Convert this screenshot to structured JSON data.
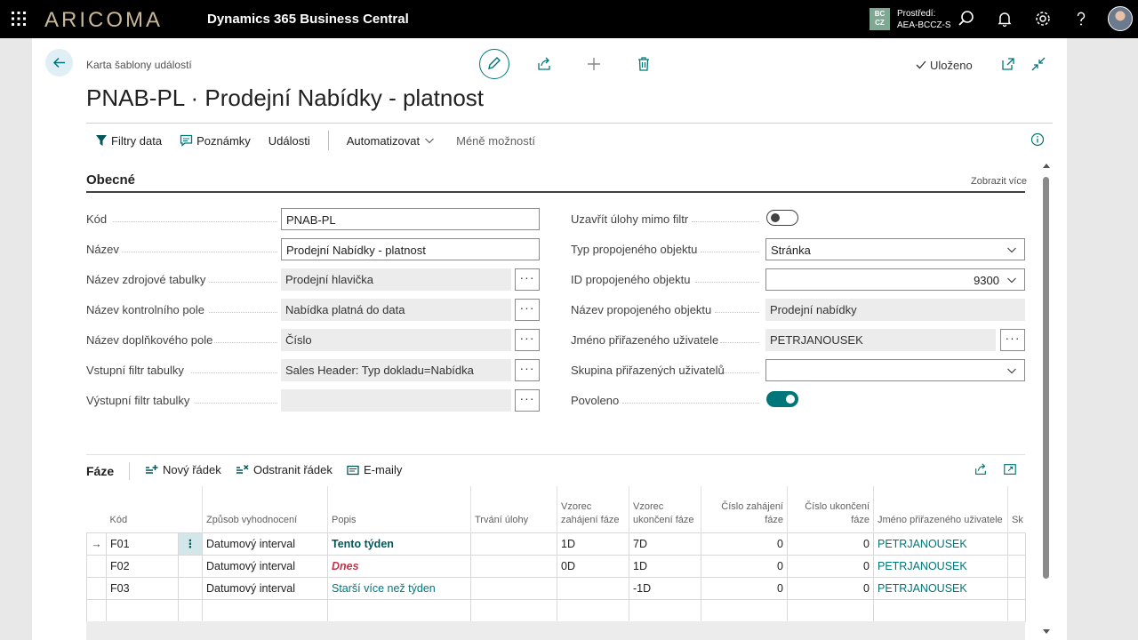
{
  "topbar": {
    "logo": "ARICOMA",
    "app_title": "Dynamics 365 Business Central",
    "env_badge_line1": "BC",
    "env_badge_line2": "CZ",
    "env_label": "Prostředí:",
    "env_name": "AEA-BCCZ-S"
  },
  "header": {
    "breadcrumb": "Karta šablony událostí",
    "title": "PNAB-PL · Prodejní Nabídky - platnost",
    "saved_label": "Uloženo"
  },
  "actions": {
    "filters": "Filtry data",
    "notes": "Poznámky",
    "events": "Události",
    "automate": "Automatizovat",
    "fewer": "Méně možností"
  },
  "section": {
    "title": "Obecné",
    "show_more": "Zobrazit více"
  },
  "fields_left": [
    {
      "label": "Kód",
      "value": "PNAB-PL"
    },
    {
      "label": "Název",
      "value": "Prodejní Nabídky - platnost"
    },
    {
      "label": "Název zdrojové tabulky",
      "value": "Prodejní hlavička"
    },
    {
      "label": "Název kontrolního pole",
      "value": "Nabídka platná do data"
    },
    {
      "label": "Název doplňkového pole",
      "value": "Číslo"
    },
    {
      "label": "Vstupní filtr tabulky",
      "value": "Sales Header: Typ dokladu=Nabídka"
    },
    {
      "label": "Výstupní filtr tabulky",
      "value": ""
    }
  ],
  "fields_right": [
    {
      "label": "Uzavřít úlohy mimo filtr",
      "value": "off"
    },
    {
      "label": "Typ propojeného objektu",
      "value": "Stránka"
    },
    {
      "label": "ID propojeného objektu",
      "value": "9300"
    },
    {
      "label": "Název propojeného objektu",
      "value": "Prodejní nabídky"
    },
    {
      "label": "Jméno přiřazeného uživatele",
      "value": "PETRJANOUSEK"
    },
    {
      "label": "Skupina přiřazených uživatelů",
      "value": ""
    },
    {
      "label": "Povoleno",
      "value": "on"
    }
  ],
  "lines": {
    "title": "Fáze",
    "new_line": "Nový řádek",
    "delete_line": "Odstranit řádek",
    "emails": "E-maily",
    "columns": {
      "code": "Kód",
      "method": "Způsob vyhodnocení",
      "desc": "Popis",
      "duration": "Trvání úlohy",
      "start_formula": "Vzorec zahájení fáze",
      "end_formula": "Vzorec ukončení fáze",
      "start_no": "Číslo zahájení fáze",
      "end_no": "Číslo ukončení fáze",
      "user": "Jméno přiřazeného uživatele",
      "group": "Sk pří uži"
    },
    "rows": [
      {
        "code": "F01",
        "method": "Datumový interval",
        "desc": "Tento týden",
        "duration": "",
        "start": "1D",
        "end": "7D",
        "start_no": "0",
        "end_no": "0",
        "user": "PETRJANOUSEK"
      },
      {
        "code": "F02",
        "method": "Datumový interval",
        "desc": "Dnes",
        "duration": "",
        "start": "0D",
        "end": "1D",
        "start_no": "0",
        "end_no": "0",
        "user": "PETRJANOUSEK"
      },
      {
        "code": "F03",
        "method": "Datumový interval",
        "desc": "Starší více než týden",
        "duration": "",
        "start": "",
        "end": "-1D",
        "start_no": "0",
        "end_no": "0",
        "user": "PETRJANOUSEK"
      }
    ]
  },
  "colors": {
    "accent": "#00767a",
    "red": "#c4314b",
    "topbar": "#000000"
  }
}
